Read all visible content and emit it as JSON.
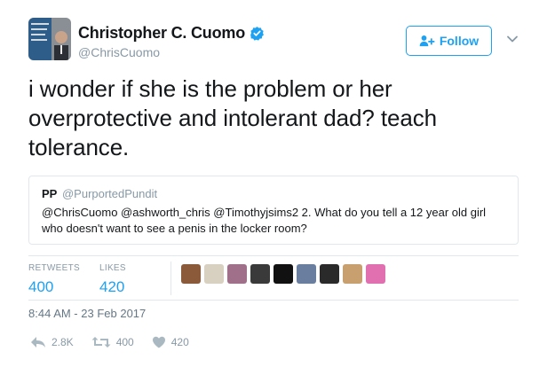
{
  "author": {
    "name": "Christopher C. Cuomo",
    "handle": "@ChrisCuomo",
    "verified": true,
    "avatar_icon": "profile-photo"
  },
  "follow_button": {
    "label": "Follow",
    "icon": "add-user-icon"
  },
  "menu_icon": "chevron-down-icon",
  "tweet": {
    "text": "i wonder if she is the problem or her overprotective and intolerant dad? teach tolerance."
  },
  "quoted_tweet": {
    "name": "PP",
    "handle": "@PurportedPundit",
    "text": "@ChrisCuomo @ashworth_chris @Timothyjsims2 2. What do you tell a 12 year old girl who doesn't want to see a penis in the locker room?"
  },
  "stats": {
    "retweets_label": "RETWEETS",
    "retweets_value": "400",
    "likes_label": "LIKES",
    "likes_value": "420"
  },
  "liker_avatars": [
    "#8a5a3a",
    "#d8d0c0",
    "#a0708a",
    "#3a3a3a",
    "#111111",
    "#6a7fa0",
    "#2a2a2a",
    "#c8a070",
    "#e070b0"
  ],
  "timestamp": "8:44 AM - 23 Feb 2017",
  "actions": {
    "reply_count": "2.8K",
    "retweet_count": "400",
    "like_count": "420"
  },
  "colors": {
    "accent": "#1da1f2",
    "muted": "#8899a6",
    "text": "#14171a",
    "border": "#e1e8ed"
  }
}
